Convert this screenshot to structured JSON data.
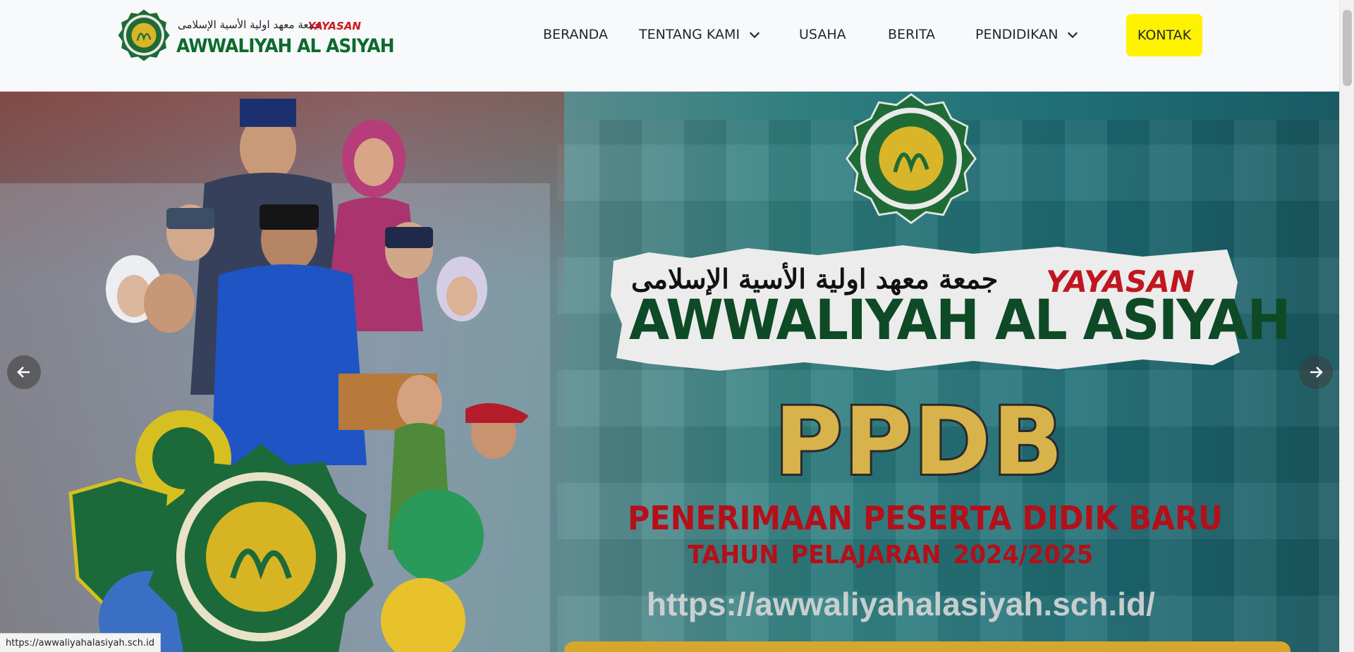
{
  "header": {
    "logo": {
      "arabic": "جمعة معهد اولية الأسية الإسلامى",
      "yayasan": "YAYASAN",
      "name": "AWWALIYAH AL ASIYAH"
    },
    "nav": [
      {
        "label": "BERANDA",
        "dropdown": false
      },
      {
        "label": "TENTANG KAMI",
        "dropdown": true
      },
      {
        "label": "USAHA",
        "dropdown": false
      },
      {
        "label": "BERITA",
        "dropdown": false
      },
      {
        "label": "PENDIDIKAN",
        "dropdown": true
      }
    ],
    "cta": "KONTAK",
    "cta_color": "#fff200"
  },
  "hero": {
    "banner_arabic": "جمعة معهد اولية الأسية الإسلامى",
    "banner_yayasan": "YAYASAN",
    "banner_name": "AWWALIYAH AL ASIYAH",
    "ppdb": "PPDB",
    "ppdb_full": "PENERIMAAN PESERTA DIDIK BARU",
    "ppdb_year": "TAHUN  PELAJARAN 2024/2025",
    "url": "https://awwaliyahalasiyah.sch.id/",
    "prev_icon": "arrow-left-icon",
    "next_icon": "arrow-right-icon",
    "accent_red": "#b3101a",
    "accent_green": "#0d4a25",
    "accent_gold": "#d8b24a"
  },
  "status_bar": {
    "url": "https://awwaliyahalasiyah.sch.id"
  }
}
